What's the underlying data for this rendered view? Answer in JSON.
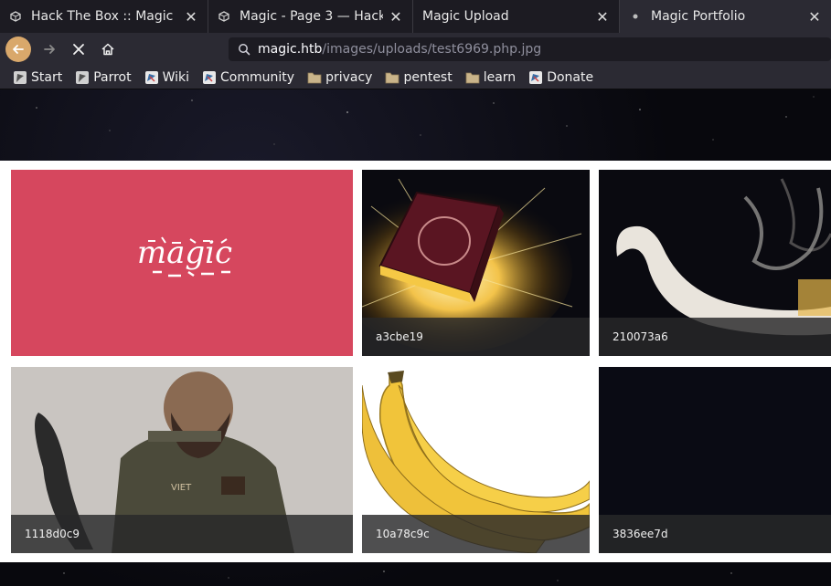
{
  "tabs": [
    {
      "label": "Hack The Box :: Magic",
      "favicon": "hackthebox-cube-icon"
    },
    {
      "label": "Magic - Page 3 — Hack Th",
      "favicon": "hackthebox-cube-icon"
    },
    {
      "label": "Magic Upload",
      "favicon": ""
    },
    {
      "label": "Magic Portfolio",
      "favicon": "loading-dot-icon"
    }
  ],
  "nav": {
    "url_host": "magic.htb",
    "url_path": "/images/uploads/test6969.php.jpg"
  },
  "bookmarks": [
    {
      "label": "Start",
      "icon": "parrot-icon"
    },
    {
      "label": "Parrot",
      "icon": "parrot-icon"
    },
    {
      "label": "Wiki",
      "icon": "parrot-wiki-icon"
    },
    {
      "label": "Community",
      "icon": "parrot-wiki-icon"
    },
    {
      "label": "privacy",
      "icon": "folder-icon"
    },
    {
      "label": "pentest",
      "icon": "folder-icon"
    },
    {
      "label": "learn",
      "icon": "folder-icon"
    },
    {
      "label": "Donate",
      "icon": "parrot-wiki-icon"
    }
  ],
  "gallery": {
    "cards": [
      {
        "caption": "",
        "logo": "magic"
      },
      {
        "caption": "a3cbe19"
      },
      {
        "caption": "210073a6"
      },
      {
        "caption": "1118d0c9"
      },
      {
        "caption": "10a78c9c"
      },
      {
        "caption": "3836ee7d"
      }
    ]
  },
  "colors": {
    "accent_back": "#d9a86b",
    "magic_card": "#d6475e"
  }
}
